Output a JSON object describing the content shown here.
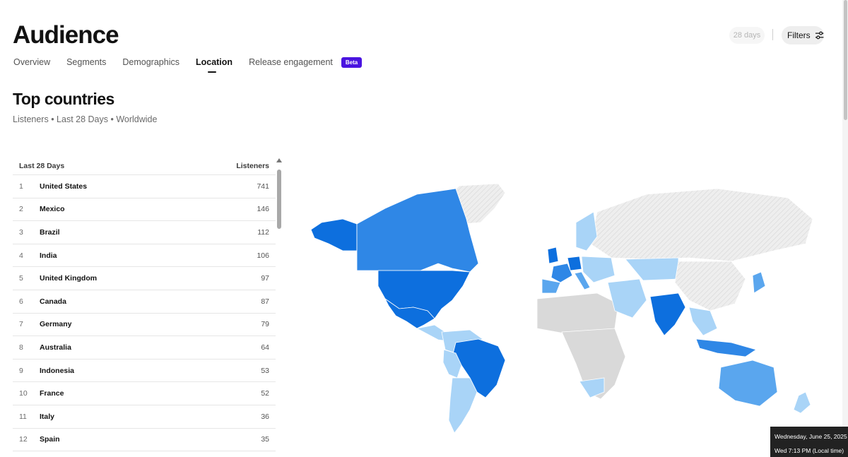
{
  "header": {
    "title": "Audience",
    "range_chip": "28 days",
    "filters_label": "Filters"
  },
  "tabs": [
    {
      "label": "Overview",
      "active": false
    },
    {
      "label": "Segments",
      "active": false
    },
    {
      "label": "Demographics",
      "active": false
    },
    {
      "label": "Location",
      "active": true
    },
    {
      "label": "Release engagement",
      "active": false,
      "badge": "Beta"
    }
  ],
  "section": {
    "title": "Top countries",
    "subtitle": "Listeners • Last 28 Days • Worldwide"
  },
  "table": {
    "col_period": "Last 28 Days",
    "col_metric": "Listeners",
    "rows": [
      {
        "rank": "1",
        "country": "United States",
        "listeners": "741"
      },
      {
        "rank": "2",
        "country": "Mexico",
        "listeners": "146"
      },
      {
        "rank": "3",
        "country": "Brazil",
        "listeners": "112"
      },
      {
        "rank": "4",
        "country": "India",
        "listeners": "106"
      },
      {
        "rank": "5",
        "country": "United Kingdom",
        "listeners": "97"
      },
      {
        "rank": "6",
        "country": "Canada",
        "listeners": "87"
      },
      {
        "rank": "7",
        "country": "Germany",
        "listeners": "79"
      },
      {
        "rank": "8",
        "country": "Australia",
        "listeners": "64"
      },
      {
        "rank": "9",
        "country": "Indonesia",
        "listeners": "53"
      },
      {
        "rank": "10",
        "country": "France",
        "listeners": "52"
      },
      {
        "rank": "11",
        "country": "Italy",
        "listeners": "36"
      },
      {
        "rank": "12",
        "country": "Spain",
        "listeners": "35"
      }
    ]
  },
  "map_colors": {
    "high": "#0d6fde",
    "mid": "#2f87e6",
    "low": "#5aa6ee",
    "lower": "#a9d4f7",
    "none": "#d9d9d9",
    "hatched": "#eeeeee"
  },
  "tooltip": {
    "line1": "Wednesday, June 25, 2025",
    "line2": "Wed 7:13 PM (Local time)"
  }
}
